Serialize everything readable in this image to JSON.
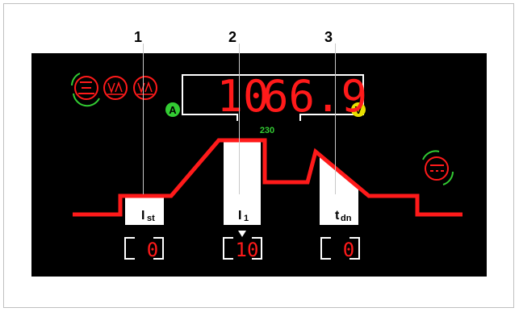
{
  "callouts": [
    "1",
    "2",
    "3"
  ],
  "display": {
    "current_value": "10",
    "voltage_value": "66.9",
    "current_unit": "A",
    "voltage_unit": "V",
    "mains_voltage": "230"
  },
  "mode_icons": [
    "electrode-welding-icon",
    "volt-ampere-icon",
    "volt-ampere-icon"
  ],
  "dc_icon": "dc-current-icon",
  "parameters": [
    {
      "label_main": "I",
      "label_sub": "st",
      "value": "0"
    },
    {
      "label_main": "I",
      "label_sub": "1",
      "value": "10"
    },
    {
      "label_main": "t",
      "label_sub": "dn",
      "value": "0"
    }
  ],
  "colors": {
    "panel": "#000000",
    "red": "#ff1a1a",
    "green": "#33cc33",
    "yellow": "#e8e000",
    "white": "#ffffff"
  }
}
